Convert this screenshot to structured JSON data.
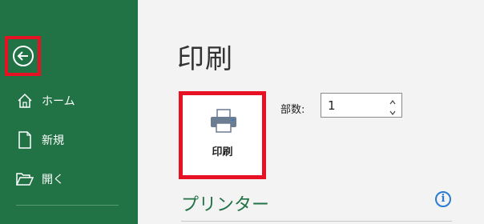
{
  "sidebar": {
    "back_icon": "arrow-left-circle-icon",
    "items": [
      {
        "label": "ホーム",
        "icon": "home-icon"
      },
      {
        "label": "新規",
        "icon": "new-document-icon"
      },
      {
        "label": "開く",
        "icon": "open-folder-icon"
      }
    ],
    "accent_color": "#217346"
  },
  "main": {
    "title": "印刷",
    "print_button": {
      "label": "印刷",
      "icon": "printer-icon"
    },
    "copies": {
      "label": "部数:",
      "value": "1"
    },
    "printer_section": {
      "heading": "プリンター",
      "info_icon": "info-icon"
    }
  },
  "highlight_color": "#e81123"
}
